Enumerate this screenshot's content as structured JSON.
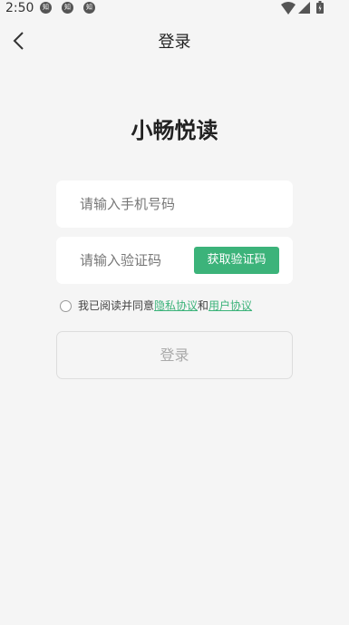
{
  "status_bar": {
    "time": "2:50",
    "notification_badge": "知"
  },
  "nav": {
    "title": "登录"
  },
  "app": {
    "name": "小畅悦读"
  },
  "form": {
    "phone_placeholder": "请输入手机号码",
    "code_placeholder": "请输入验证码",
    "get_code_label": "获取验证码"
  },
  "agreement": {
    "prefix": "我已阅读并同意",
    "privacy_label": "隐私协议",
    "conjunction": "和",
    "user_label": "用户协议"
  },
  "login_button": {
    "label": "登录"
  },
  "colors": {
    "accent": "#3cb37a",
    "background": "#f5f5f5"
  }
}
